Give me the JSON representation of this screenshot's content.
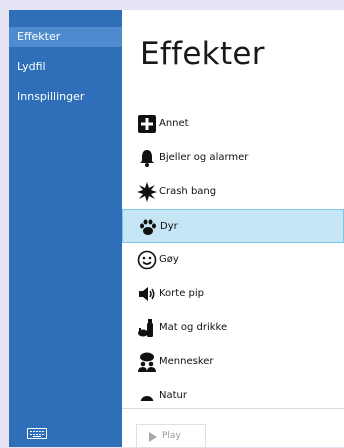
{
  "sidebar": {
    "items": [
      {
        "label": "Effekter"
      },
      {
        "label": "Lydfil"
      },
      {
        "label": "Innspillinger"
      }
    ]
  },
  "main": {
    "title": "Effekter",
    "categories": [
      {
        "label": "Annet",
        "icon": "plus-icon"
      },
      {
        "label": "Bjeller og alarmer",
        "icon": "bell-icon"
      },
      {
        "label": "Crash bang",
        "icon": "explosion-icon"
      },
      {
        "label": "Dyr",
        "icon": "paw-icon",
        "selected": true
      },
      {
        "label": "Gøy",
        "icon": "smiley-icon"
      },
      {
        "label": "Korte pip",
        "icon": "speaker-icon"
      },
      {
        "label": "Mat og drikke",
        "icon": "food-drink-icon"
      },
      {
        "label": "Mennesker",
        "icon": "people-icon"
      },
      {
        "label": "Natur",
        "icon": "nature-icon"
      }
    ],
    "play_label": "Play"
  },
  "colors": {
    "sidebar": "#2f6fba",
    "sidebar_active": "#4e8ccf",
    "selected_row": "#c6e6f6",
    "selected_border": "#7fc4e8"
  }
}
